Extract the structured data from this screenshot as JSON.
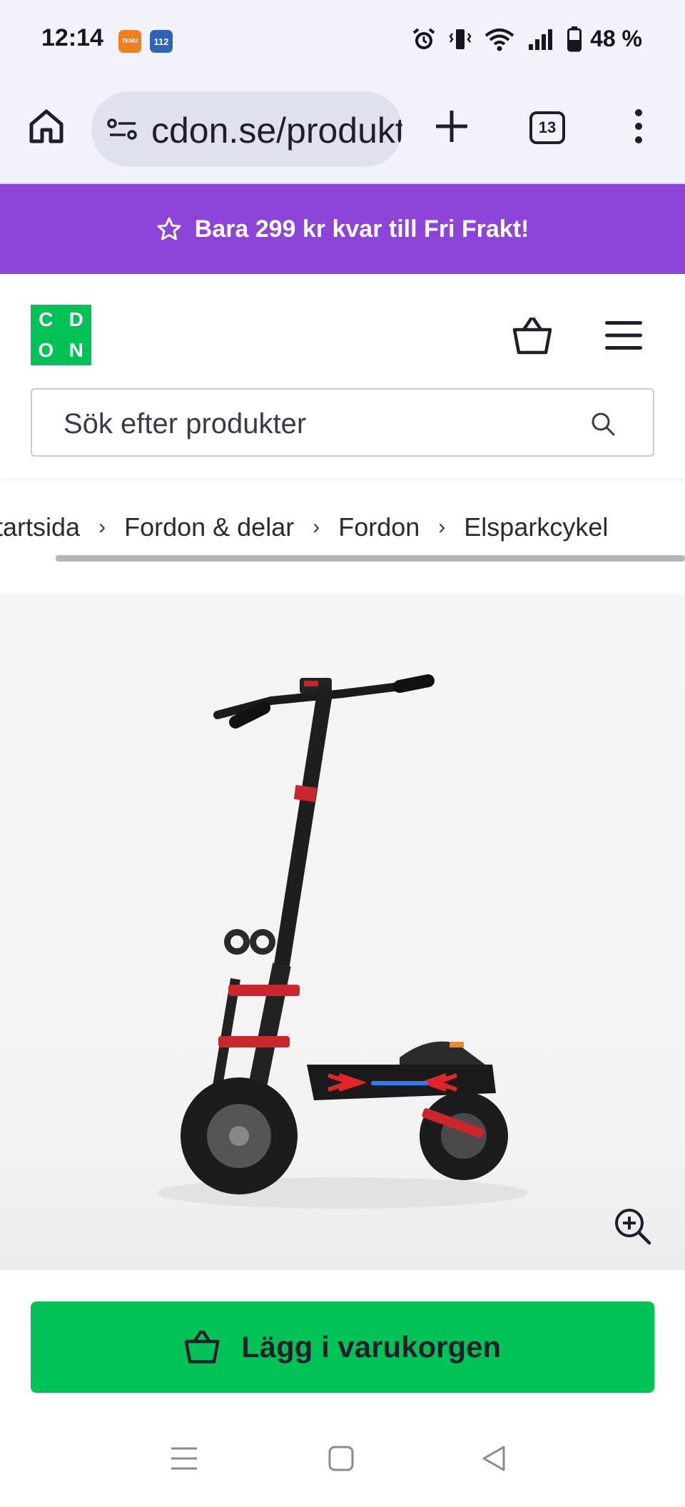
{
  "status_bar": {
    "time": "12:14",
    "notifications": [
      "TEMU",
      "112"
    ],
    "battery": "48 %"
  },
  "browser": {
    "url": "cdon.se/produkt",
    "tab_count": "13"
  },
  "promo": {
    "text": "Bara 299 kr kvar till Fri Frakt!"
  },
  "header": {
    "logo_letters": [
      "C",
      "D",
      "O",
      "N"
    ],
    "search_placeholder": "Sök efter produkter"
  },
  "breadcrumb": {
    "items": [
      "Startsida",
      "Fordon & delar",
      "Fordon",
      "Elsparkcykel"
    ]
  },
  "product": {
    "image_alt": "Electric scooter"
  },
  "cta": {
    "label": "Lägg i varukorgen"
  },
  "colors": {
    "brand_green": "#00c257",
    "promo_purple": "#8d44d8",
    "browser_bg": "#f2f2fa"
  }
}
